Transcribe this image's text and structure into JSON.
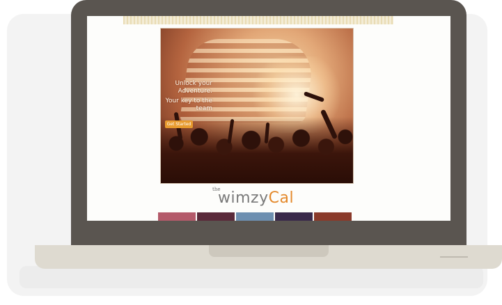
{
  "hero": {
    "headline": "Unlock your Adventure.",
    "tagline": "Your key to the team",
    "button_label": "Get Started"
  },
  "logo": {
    "prefix": "the",
    "name_gray": "wimzy",
    "name_orange": "Cal"
  },
  "colors": {
    "laptop_frame": "#5a5550",
    "laptop_base": "#dedad0",
    "accent": "#e4892b"
  }
}
